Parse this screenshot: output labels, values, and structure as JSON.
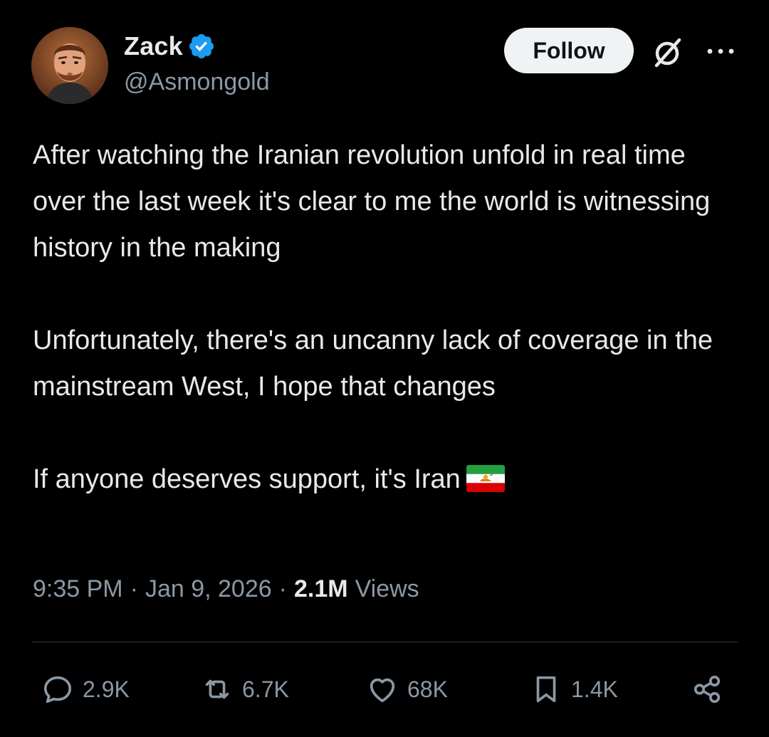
{
  "author": {
    "display_name": "Zack",
    "handle": "@Asmongold",
    "verified": true
  },
  "header": {
    "follow_label": "Follow"
  },
  "tweet": {
    "paragraphs": [
      "After watching the Iranian revolution unfold in real time over the last week it's clear to me the world is witnessing history in the making",
      "Unfortunately, there's an uncanny lack of coverage in the mainstream West, I hope that changes",
      "If anyone deserves support, it's Iran"
    ],
    "emoji": "iran-lion-and-sun-flag"
  },
  "meta": {
    "time": "9:35 PM",
    "date": "Jan 9, 2026",
    "views_count": "2.1M",
    "views_label": "Views",
    "separator": "·"
  },
  "actions": {
    "replies": "2.9K",
    "reposts": "6.7K",
    "likes": "68K",
    "bookmarks": "1.4K"
  },
  "colors": {
    "background": "#000000",
    "text_primary": "#e7e9ea",
    "text_secondary": "#8b98a5",
    "verified_blue": "#1d9bf0",
    "divider": "#2f3336",
    "follow_button_bg": "#eff3f4"
  }
}
